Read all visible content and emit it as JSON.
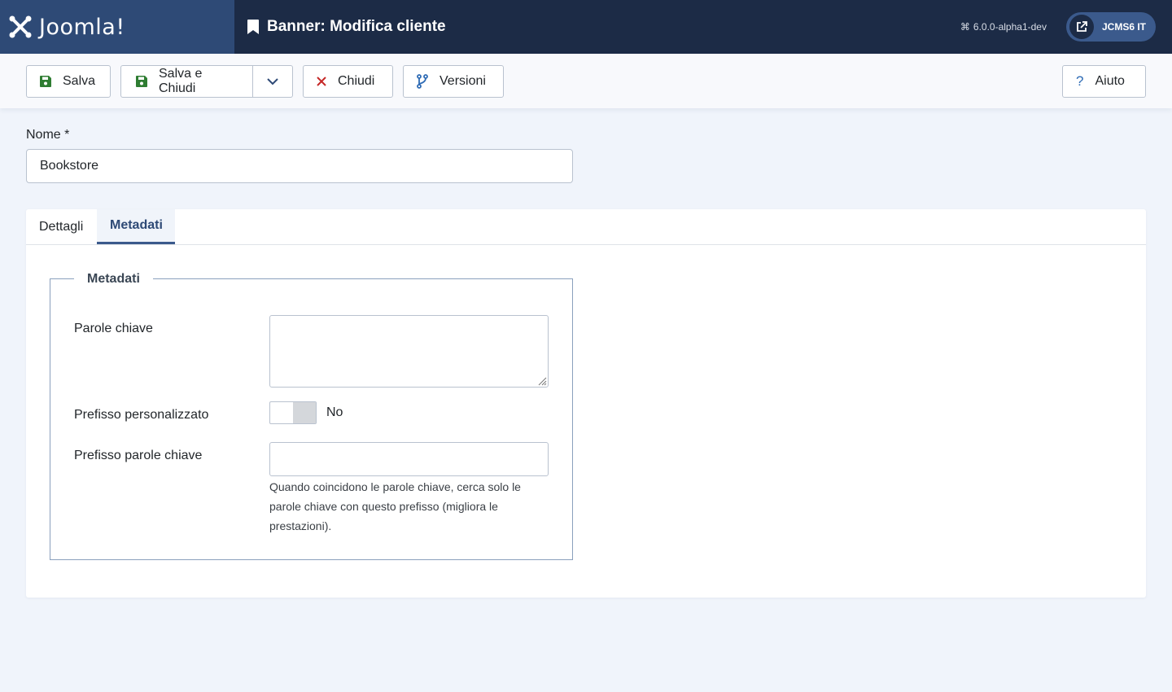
{
  "header": {
    "logo_text": "Joomla!",
    "page_title": "Banner: Modifica cliente",
    "version": "6.0.0-alpha1-dev",
    "site_button": "JCMS6 IT"
  },
  "toolbar": {
    "save": "Salva",
    "save_close": "Salva e Chiudi",
    "close": "Chiudi",
    "versions": "Versioni",
    "help": "Aiuto"
  },
  "form": {
    "name_label": "Nome *",
    "name_value": "Bookstore"
  },
  "tabs": [
    {
      "label": "Dettagli",
      "active": false
    },
    {
      "label": "Metadati",
      "active": true
    }
  ],
  "metadata": {
    "legend": "Metadati",
    "keywords_label": "Parole chiave",
    "keywords_value": "",
    "custom_prefix_label": "Prefisso personalizzato",
    "custom_prefix_state": "No",
    "keyword_prefix_label": "Prefisso parole chiave",
    "keyword_prefix_value": "",
    "keyword_prefix_help": "Quando coincidono le parole chiave, cerca solo le parole chiave con questo prefisso (migliora le prestazioni)."
  },
  "colors": {
    "header_bg": "#1c2b46",
    "logo_bg": "#2e4a76",
    "accent": "#3b5a8c",
    "save_icon": "#2f7d32",
    "close_icon": "#c52827"
  }
}
